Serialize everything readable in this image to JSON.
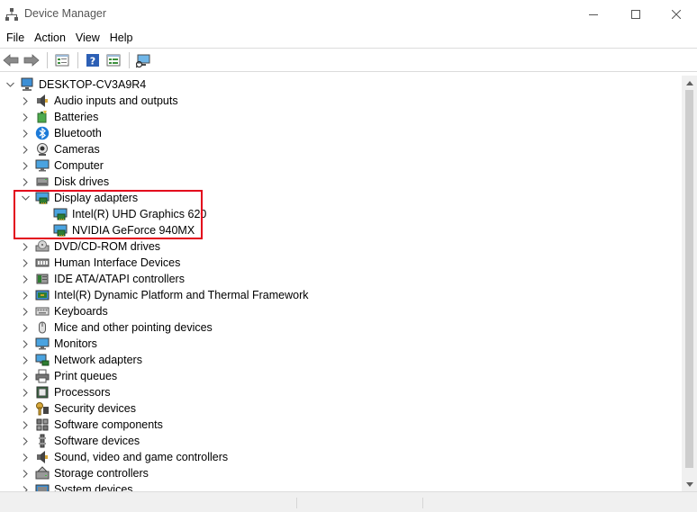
{
  "window": {
    "title": "Device Manager",
    "min_glyph": "—",
    "max_glyph": "☐",
    "close_glyph": "✕"
  },
  "menu": [
    "File",
    "Action",
    "View",
    "Help"
  ],
  "toolbar": {
    "icons": [
      "back-arrow-icon",
      "forward-arrow-icon",
      "properties-icon",
      "help-icon",
      "details-view-icon",
      "scan-hardware-icon"
    ]
  },
  "tree": {
    "root": "DESKTOP-CV3A9R4",
    "categories": [
      {
        "label": "Audio inputs and outputs",
        "icon": "speaker-icon",
        "expanded": false
      },
      {
        "label": "Batteries",
        "icon": "battery-icon",
        "expanded": false
      },
      {
        "label": "Bluetooth",
        "icon": "bluetooth-icon",
        "expanded": false
      },
      {
        "label": "Cameras",
        "icon": "camera-icon",
        "expanded": false
      },
      {
        "label": "Computer",
        "icon": "monitor-icon",
        "expanded": false
      },
      {
        "label": "Disk drives",
        "icon": "disk-drive-icon",
        "expanded": false
      },
      {
        "label": "Display adapters",
        "icon": "display-adapter-icon",
        "expanded": true,
        "children": [
          "Intel(R) UHD Graphics 620",
          "NVIDIA GeForce 940MX"
        ]
      },
      {
        "label": "DVD/CD-ROM drives",
        "icon": "dvd-drive-icon",
        "expanded": false
      },
      {
        "label": "Human Interface Devices",
        "icon": "hid-icon",
        "expanded": false
      },
      {
        "label": "IDE ATA/ATAPI controllers",
        "icon": "ide-controller-icon",
        "expanded": false
      },
      {
        "label": "Intel(R) Dynamic Platform and Thermal Framework",
        "icon": "chip-icon",
        "expanded": false
      },
      {
        "label": "Keyboards",
        "icon": "keyboard-icon",
        "expanded": false
      },
      {
        "label": "Mice and other pointing devices",
        "icon": "mouse-icon",
        "expanded": false
      },
      {
        "label": "Monitors",
        "icon": "monitor-icon",
        "expanded": false
      },
      {
        "label": "Network adapters",
        "icon": "network-icon",
        "expanded": false
      },
      {
        "label": "Print queues",
        "icon": "printer-icon",
        "expanded": false
      },
      {
        "label": "Processors",
        "icon": "processor-icon",
        "expanded": false
      },
      {
        "label": "Security devices",
        "icon": "security-key-icon",
        "expanded": false
      },
      {
        "label": "Software components",
        "icon": "software-component-icon",
        "expanded": false
      },
      {
        "label": "Software devices",
        "icon": "software-device-icon",
        "expanded": false
      },
      {
        "label": "Sound, video and game controllers",
        "icon": "speaker-icon",
        "expanded": false
      },
      {
        "label": "Storage controllers",
        "icon": "storage-controller-icon",
        "expanded": false
      },
      {
        "label": "System devices",
        "icon": "system-device-icon",
        "expanded": false
      }
    ]
  },
  "colors": {
    "highlight_border": "#e3001b",
    "accent_blue": "#2f8fd6"
  }
}
